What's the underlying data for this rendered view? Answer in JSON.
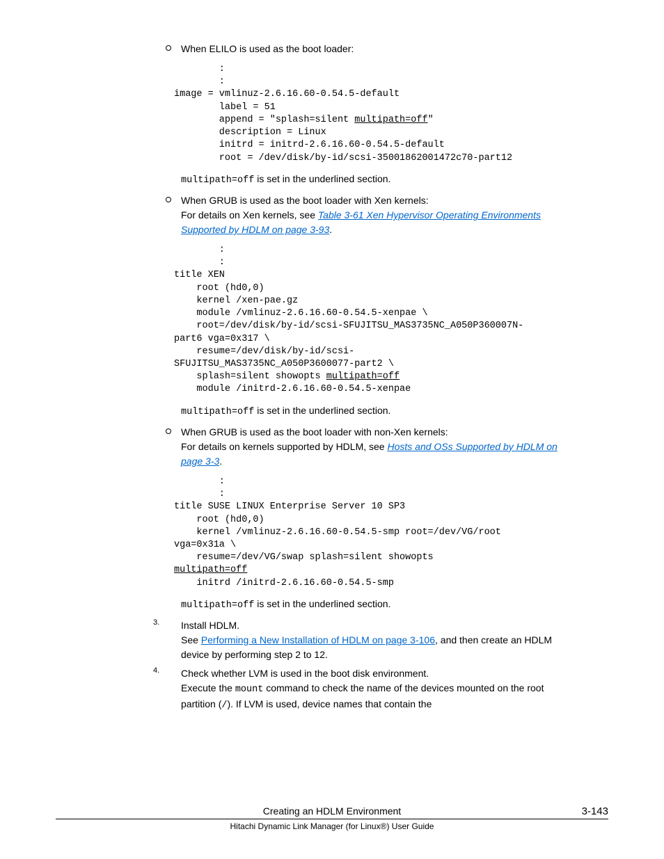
{
  "bullets": {
    "elilo": {
      "heading": "When ELILO is used as the boot loader:",
      "code_pre": "        :\n        :\nimage = vmlinuz-2.6.16.60-0.54.5-default\n        label = 51\n        append = \"splash=silent ",
      "code_u": "multipath=off",
      "code_post": "\"\n        description = Linux\n        initrd = initrd-2.6.16.60-0.54.5-default\n        root = /dev/disk/by-id/scsi-35001862001472c70-part12",
      "after_pre": "multipath=off",
      "after_post": " is set in the underlined section."
    },
    "grub_xen": {
      "heading": "When GRUB is used as the boot loader with Xen kernels:",
      "subline_pre": "For details on Xen kernels, see ",
      "subline_link": "Table 3-61 Xen Hypervisor Operating Environments Supported by HDLM on page 3-93",
      "subline_post": ".",
      "code_pre": "        :\n        :\ntitle XEN\n    root (hd0,0)\n    kernel /xen-pae.gz\n    module /vmlinuz-2.6.16.60-0.54.5-xenpae \\\n    root=/dev/disk/by-id/scsi-SFUJITSU_MAS3735NC_A050P360007N-\npart6 vga=0x317 \\\n    resume=/dev/disk/by-id/scsi-\nSFUJITSU_MAS3735NC_A050P3600077-part2 \\\n    splash=silent showopts ",
      "code_u": "multipath=off",
      "code_post": "\n    module /initrd-2.6.16.60-0.54.5-xenpae",
      "after_pre": "multipath=off",
      "after_post": " is set in the underlined section."
    },
    "grub_nonxen": {
      "heading": "When GRUB is used as the boot loader with non-Xen kernels:",
      "subline_pre": "For details on kernels supported by HDLM, see ",
      "subline_link": "Hosts and OSs Supported by HDLM on page 3-3",
      "subline_post": ".",
      "code_pre": "        :\n        :\ntitle SUSE LINUX Enterprise Server 10 SP3\n    root (hd0,0)\n    kernel /vmlinuz-2.6.16.60-0.54.5-smp root=/dev/VG/root \nvga=0x31a \\\n    resume=/dev/VG/swap splash=silent showopts \n",
      "code_u": "multipath=off",
      "code_post": "\n    initrd /initrd-2.6.16.60-0.54.5-smp",
      "after_pre": "multipath=off",
      "after_post": " is set in the underlined section."
    }
  },
  "steps": {
    "s3": {
      "num": "3.",
      "line1": "Install HDLM.",
      "line2_pre": "See ",
      "line2_link": "Performing a New Installation of HDLM on page 3-106",
      "line2_post": ", and then create an HDLM device by performing step 2 to 12."
    },
    "s4": {
      "num": "4.",
      "line1": "Check whether LVM is used in the boot disk environment.",
      "line2_pre": "Execute the ",
      "line2_mono": "mount",
      "line2_mid": " command to check the name of the devices mounted on the root partition (",
      "line2_mono2": "/",
      "line2_post": "). If LVM is used, device names that contain the"
    }
  },
  "footer": {
    "title": "Creating an HDLM Environment",
    "pagenum": "3-143",
    "subtitle": "Hitachi Dynamic Link Manager (for Linux®) User Guide"
  }
}
